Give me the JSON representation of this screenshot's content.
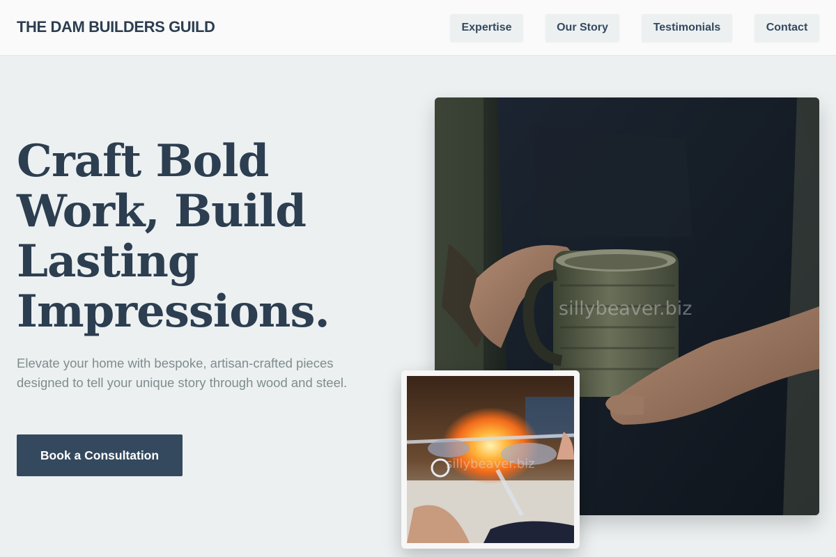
{
  "header": {
    "logo": "THE DAM BUILDERS GUILD",
    "nav": [
      "Expertise",
      "Our Story",
      "Testimonials",
      "Contact"
    ]
  },
  "hero": {
    "title": "Craft Bold Work, Build Lasting Impressions.",
    "subtitle": "Elevate your home with bespoke, artisan-crafted pieces designed to tell your unique story through wood and steel.",
    "cta": "Book a Consultation"
  },
  "images": {
    "main_watermark": "sillybeaver.biz",
    "inset_watermark": "sillybeaver.biz"
  },
  "colors": {
    "background": "#ecf0f1",
    "header_bg": "#fafafa",
    "primary": "#34495e",
    "heading": "#2c3e50",
    "muted_text": "#7f8c8d"
  }
}
